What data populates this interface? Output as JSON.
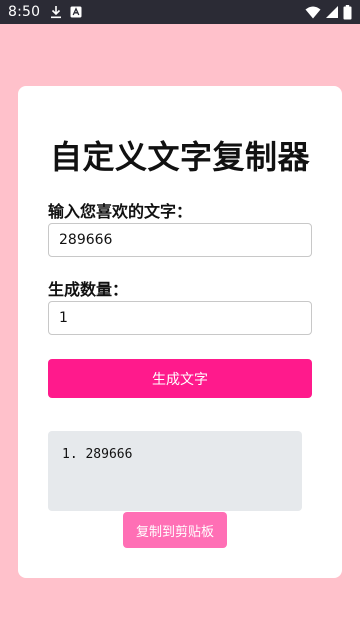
{
  "status_bar": {
    "time": "8:50",
    "icons": [
      "download-icon",
      "notification-a-icon",
      "wifi-icon",
      "signal-icon",
      "battery-icon"
    ]
  },
  "app": {
    "title": "自定义文字复制器",
    "text_label": "输入您喜欢的文字：",
    "text_value": "289666",
    "count_label": "生成数量：",
    "count_value": "1",
    "generate_label": "生成文字",
    "output_lines": [
      "1. 289666"
    ],
    "copy_label": "复制到剪贴板"
  },
  "colors": {
    "background": "#ffc1cb",
    "status_bar": "#2b2b35",
    "card": "#ffffff",
    "generate_button": "#ff1a8c",
    "copy_button": "#ff6fb5",
    "output_box": "#e6e9ec"
  }
}
